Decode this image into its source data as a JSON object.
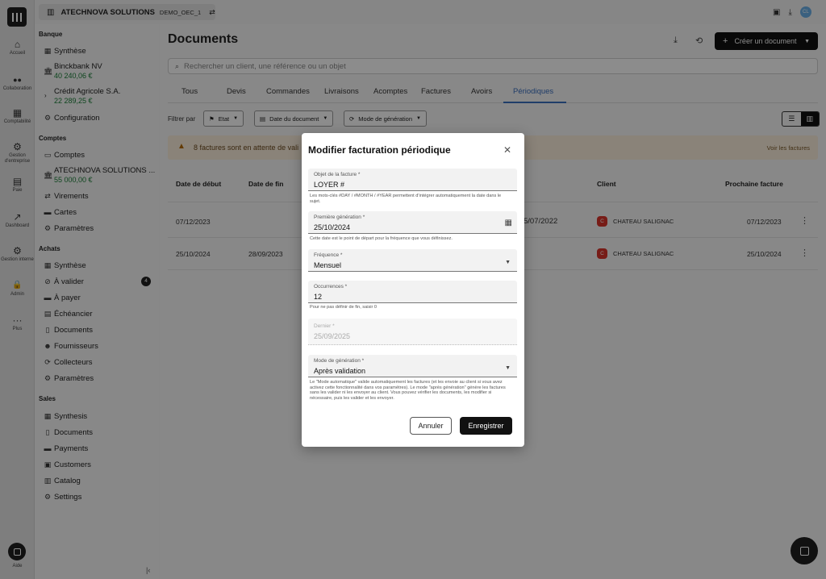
{
  "topbar": {
    "company": "ATECHNOVA SOLUTIONS",
    "db": "DEMO_OEC_1",
    "avatar": "CL"
  },
  "rail": [
    {
      "icon": "⌂",
      "label": "Accueil"
    },
    {
      "icon": "👥",
      "label": "Collaboration"
    },
    {
      "icon": "▦",
      "label": "Comptabilité"
    },
    {
      "icon": "⚙",
      "label": "Gestion d'entreprise"
    },
    {
      "icon": "▤",
      "label": "Paie"
    },
    {
      "icon": "↗",
      "label": "Dashboard"
    },
    {
      "icon": "⚙",
      "label": "Gestion interne"
    },
    {
      "icon": "🔒",
      "label": "Admin"
    },
    {
      "icon": "···",
      "label": "Plus"
    }
  ],
  "rail_help": "Aide",
  "sidebar": {
    "banque_title": "Banque",
    "banque_synthese": "Synthèse",
    "acct1_name": "Binckbank NV",
    "acct1_amount": "40 240,06 €",
    "acct2_name": "Crédit Agricole S.A.",
    "acct2_amount": "22 289,25 €",
    "banque_config": "Configuration",
    "comptes_title": "Comptes",
    "comptes_comptes": "Comptes",
    "acct3_name": "ATECHNOVA SOLUTIONS ...",
    "acct3_amount": "55 000,00 €",
    "comptes_virements": "Virements",
    "comptes_cartes": "Cartes",
    "comptes_params": "Paramètres",
    "achats_title": "Achats",
    "achats_synthese": "Synthèse",
    "achats_valider": "À valider",
    "achats_valider_count": "4",
    "achats_payer": "À payer",
    "achats_echeancier": "Échéancier",
    "achats_documents": "Documents",
    "achats_fournisseurs": "Fournisseurs",
    "achats_collecteurs": "Collecteurs",
    "achats_params": "Paramètres",
    "sales_title": "Sales",
    "sales_synthesis": "Synthesis",
    "sales_documents": "Documents",
    "sales_payments": "Payments",
    "sales_customers": "Customers",
    "sales_catalog": "Catalog",
    "sales_settings": "Settings"
  },
  "main": {
    "title": "Documents",
    "create_label": "Créer un document",
    "search_placeholder": "Rechercher un client, une référence ou un objet",
    "tabs": [
      "Tous",
      "Devis",
      "Commandes",
      "Livraisons",
      "Acomptes",
      "Factures",
      "Avoirs",
      "Périodiques"
    ],
    "filter_label": "Filtrer par",
    "filters": [
      "Etat",
      "Date du document",
      "Mode de génération"
    ],
    "alert_text": "8 factures sont en attente de vali",
    "alert_link": "Voir les factures",
    "columns": {
      "start": "Date de début",
      "end": "Date de fin",
      "client": "Client",
      "next": "Prochaine facture"
    },
    "rows": [
      {
        "start": "07/12/2023",
        "end": "",
        "mid": "5/07/2022",
        "client_initial": "C",
        "client": "CHATEAU SALIGNAC",
        "next": "07/12/2023"
      },
      {
        "start": "25/10/2024",
        "end": "28/09/2023",
        "mid": "",
        "client_initial": "C",
        "client": "CHATEAU SALIGNAC",
        "next": "25/10/2024"
      }
    ]
  },
  "modal": {
    "title": "Modifier facturation périodique",
    "objet_label": "Objet de la facture *",
    "objet_value": "LOYER #",
    "objet_help": "Les mots-clés #DAY / #MONTH / #YEAR permettent d'intégrer automatiquement la date dans le sujet.",
    "premiere_label": "Première génération *",
    "premiere_value": "25/10/2024",
    "premiere_help": "Cette date est le point de départ pour la fréquence que vous définissez.",
    "frequence_label": "Fréquence *",
    "frequence_value": "Mensuel",
    "occurrences_label": "Occurrences *",
    "occurrences_value": "12",
    "occurrences_help": "Pour ne pas définir de fin, saisir 0",
    "dernier_label": "Dernier *",
    "dernier_value": "25/09/2025",
    "mode_label": "Mode de génération *",
    "mode_value": "Après validation",
    "mode_help": "Le \"Mode automatique\" valide automatiquement les factures (et les envoie au client si vous avez activez cette fonctionnalité dans vos paramètres). Le mode \"après génération\" génère les factures sans les valider ni les envoyer au client. Vous pouvez vérifier les documents, les modifier si nécessaire, puis les valider et les envoyer.",
    "cancel": "Annuler",
    "save": "Enregistrer"
  }
}
